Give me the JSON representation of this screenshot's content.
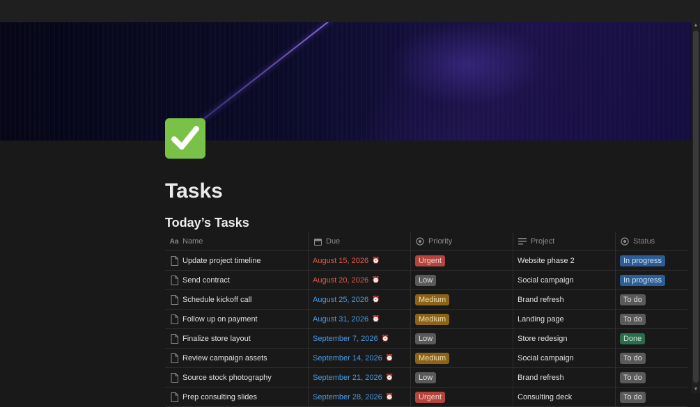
{
  "page": {
    "title": "Tasks",
    "subtitle": "Today’s Tasks"
  },
  "colors": {
    "urgent": "#b5453c",
    "low": "#5a5a5a",
    "medium": "#8c6418",
    "in_progress": "#2c5d95",
    "to_do": "#5a5a5a",
    "done": "#2b6d4a",
    "due_overdue": "#e35a4f",
    "due_upcoming": "#4a9be6"
  },
  "columns": {
    "name": {
      "label": "Name",
      "icon": "text-aa-icon"
    },
    "due": {
      "label": "Due",
      "icon": "calendar-icon"
    },
    "priority": {
      "label": "Priority",
      "icon": "status-circle-icon"
    },
    "project": {
      "label": "Project",
      "icon": "text-lines-icon"
    },
    "status": {
      "label": "Status",
      "icon": "status-circle-icon"
    }
  },
  "rows": [
    {
      "name": "Update project timeline",
      "due": "August 15, 2026",
      "due_state": "overdue",
      "priority": "Urgent",
      "project": "Website phase 2",
      "status": "In progress"
    },
    {
      "name": "Send contract",
      "due": "August 20, 2026",
      "due_state": "overdue",
      "priority": "Low",
      "project": "Social campaign",
      "status": "In progress"
    },
    {
      "name": "Schedule kickoff call",
      "due": "August 25, 2026",
      "due_state": "upcoming",
      "priority": "Medium",
      "project": "Brand refresh",
      "status": "To do"
    },
    {
      "name": "Follow up on payment",
      "due": "August 31, 2026",
      "due_state": "upcoming",
      "priority": "Medium",
      "project": "Landing page",
      "status": "To do"
    },
    {
      "name": "Finalize store layout",
      "due": "September 7, 2026",
      "due_state": "upcoming",
      "priority": "Low",
      "project": "Store redesign",
      "status": "Done"
    },
    {
      "name": "Review campaign assets",
      "due": "September 14, 2026",
      "due_state": "upcoming",
      "priority": "Medium",
      "project": "Social campaign",
      "status": "To do"
    },
    {
      "name": "Source stock photography",
      "due": "September 21, 2026",
      "due_state": "upcoming",
      "priority": "Low",
      "project": "Brand refresh",
      "status": "To do"
    },
    {
      "name": "Prep consulting slides",
      "due": "September 28, 2026",
      "due_state": "upcoming",
      "priority": "Urgent",
      "project": "Consulting deck",
      "status": "To do"
    }
  ]
}
